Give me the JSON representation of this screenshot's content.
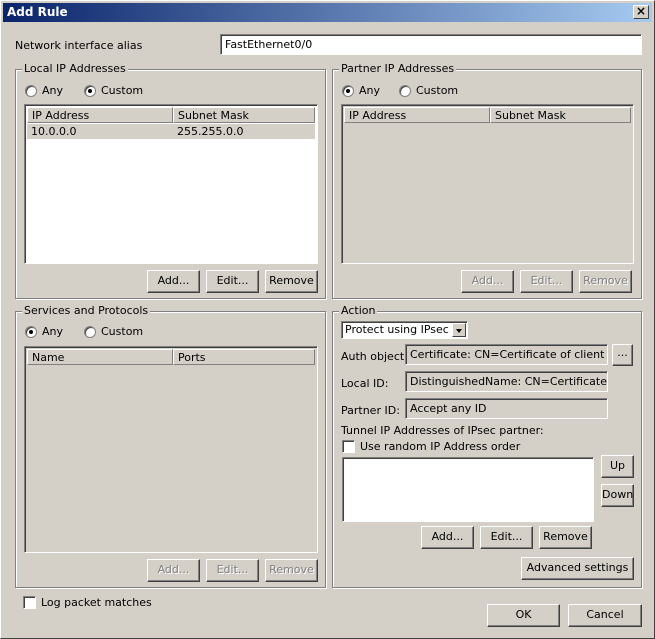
{
  "window": {
    "title": "Add Rule",
    "close_icon": "close-icon"
  },
  "alias": {
    "label": "Network interface alias",
    "value": "FastEthernet0/0"
  },
  "local_ip": {
    "title": "Local IP Addresses",
    "any_label": "Any",
    "custom_label": "Custom",
    "selected": "custom",
    "columns": [
      "IP Address",
      "Subnet Mask"
    ],
    "rows": [
      {
        "ip": "10.0.0.0",
        "mask": "255.255.0.0"
      }
    ],
    "add": "Add...",
    "edit": "Edit...",
    "remove": "Remove"
  },
  "partner_ip": {
    "title": "Partner IP Addresses",
    "any_label": "Any",
    "custom_label": "Custom",
    "selected": "any",
    "columns": [
      "IP Address",
      "Subnet Mask"
    ],
    "add": "Add...",
    "edit": "Edit...",
    "remove": "Remove"
  },
  "services": {
    "title": "Services and Protocols",
    "any_label": "Any",
    "custom_label": "Custom",
    "selected": "any",
    "columns": [
      "Name",
      "Ports"
    ],
    "add": "Add...",
    "edit": "Edit...",
    "remove": "Remove"
  },
  "action": {
    "title": "Action",
    "select_value": "Protect using IPsec",
    "auth_label": "Auth object:",
    "auth_value": "Certificate: CN=Certificate of client gate",
    "browse_label": "...",
    "local_id_label": "Local ID:",
    "local_id_value": "DistinguishedName: CN=Certificate of cl",
    "partner_id_label": "Partner ID:",
    "partner_id_value": "Accept any ID",
    "tunnel_label": "Tunnel IP Addresses of IPsec partner:",
    "random_order_label": "Use random IP Address order",
    "up": "Up",
    "down": "Down",
    "add": "Add...",
    "edit": "Edit...",
    "remove": "Remove",
    "advanced": "Advanced settings"
  },
  "footer": {
    "log_label": "Log packet matches",
    "ok": "OK",
    "cancel": "Cancel"
  }
}
